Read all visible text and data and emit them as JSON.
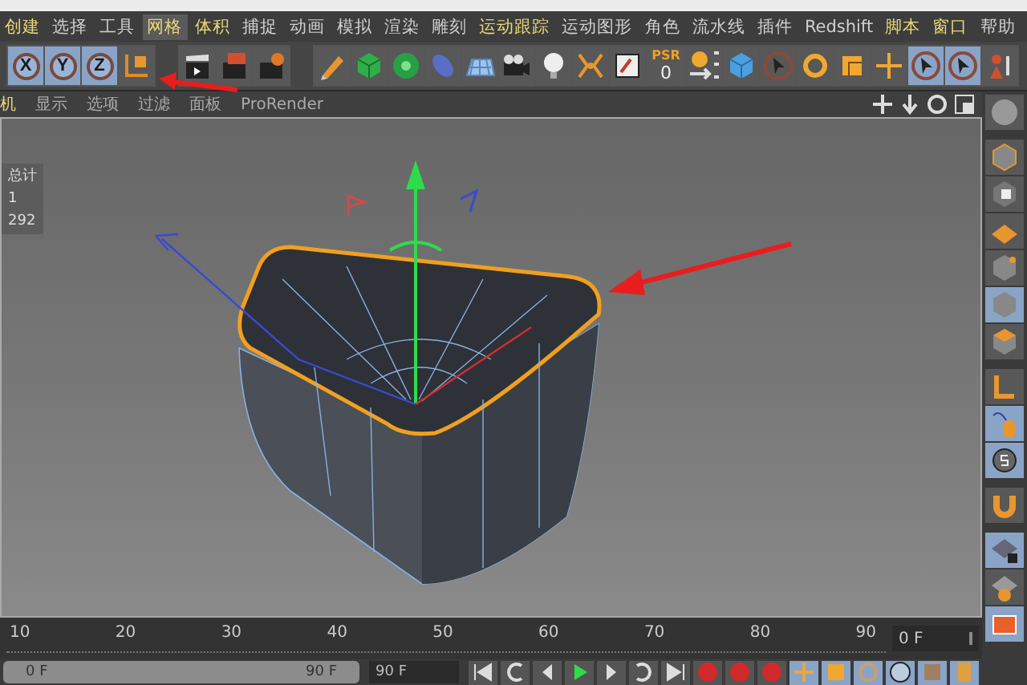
{
  "menu": [
    {
      "label": "创建",
      "color": "#e8d878",
      "selected": false
    },
    {
      "label": "选择",
      "color": "#d0d0d0",
      "selected": false
    },
    {
      "label": "工具",
      "color": "#d0d0d0",
      "selected": false
    },
    {
      "label": "网格",
      "color": "#e8d878",
      "selected": true
    },
    {
      "label": "体积",
      "color": "#e8d878",
      "selected": false
    },
    {
      "label": "捕捉",
      "color": "#d0d0d0",
      "selected": false
    },
    {
      "label": "动画",
      "color": "#d0d0d0",
      "selected": false
    },
    {
      "label": "模拟",
      "color": "#d0d0d0",
      "selected": false
    },
    {
      "label": "渲染",
      "color": "#d0d0d0",
      "selected": false
    },
    {
      "label": "雕刻",
      "color": "#d0d0d0",
      "selected": false
    },
    {
      "label": "运动跟踪",
      "color": "#e8d878",
      "selected": false
    },
    {
      "label": "运动图形",
      "color": "#d0d0d0",
      "selected": false
    },
    {
      "label": "角色",
      "color": "#d0d0d0",
      "selected": false
    },
    {
      "label": "流水线",
      "color": "#d0d0d0",
      "selected": false
    },
    {
      "label": "插件",
      "color": "#d0d0d0",
      "selected": false
    },
    {
      "label": "Redshift",
      "color": "#d0d0d0",
      "selected": false
    },
    {
      "label": "脚本",
      "color": "#e8d878",
      "selected": false
    },
    {
      "label": "窗口",
      "color": "#e8d878",
      "selected": false
    },
    {
      "label": "帮助",
      "color": "#d0d0d0",
      "selected": false
    }
  ],
  "toolbar": [
    [
      {
        "kind": "axis",
        "label": "X",
        "on": true
      },
      {
        "kind": "axis",
        "label": "Y",
        "on": true
      },
      {
        "kind": "axis",
        "label": "Z",
        "on": true
      },
      {
        "kind": "icon",
        "on": false
      }
    ],
    [
      {
        "kind": "icon",
        "on": false
      },
      {
        "kind": "icon",
        "on": false
      },
      {
        "kind": "icon",
        "on": false
      }
    ],
    [
      {
        "kind": "icon",
        "on": false
      },
      {
        "kind": "icon",
        "on": false
      },
      {
        "kind": "icon",
        "on": false
      },
      {
        "kind": "icon",
        "on": false
      },
      {
        "kind": "icon",
        "on": false
      },
      {
        "kind": "icon",
        "on": false
      },
      {
        "kind": "icon",
        "on": false
      },
      {
        "kind": "icon",
        "on": false
      },
      {
        "kind": "icon",
        "on": false
      },
      {
        "kind": "psr",
        "label": "PSR",
        "value": "0"
      },
      {
        "kind": "icon",
        "on": false
      },
      {
        "kind": "icon",
        "on": false
      },
      {
        "kind": "icon",
        "on": false
      },
      {
        "kind": "icon",
        "on": false
      },
      {
        "kind": "icon",
        "on": false
      },
      {
        "kind": "icon",
        "on": false
      },
      {
        "kind": "icon",
        "on": true
      },
      {
        "kind": "icon",
        "on": true
      },
      {
        "kind": "icon",
        "on": false
      }
    ]
  ],
  "viewport": {
    "menu": [
      "机",
      "显示",
      "选项",
      "过滤",
      "面板",
      "ProRender"
    ],
    "hud": [
      "总计",
      "1",
      "292"
    ]
  },
  "side_tools": [
    {
      "on": false
    },
    {
      "on": false
    },
    {
      "on": false
    },
    {
      "on": false
    },
    {
      "on": false
    },
    {
      "on": true
    },
    {
      "on": false
    },
    {
      "on": false
    },
    {
      "on": true
    },
    {
      "on": true
    },
    {
      "on": false
    },
    {
      "on": true
    },
    {
      "on": false
    },
    {
      "on": true
    }
  ],
  "timeline": {
    "ticks": [
      "10",
      "20",
      "30",
      "40",
      "50",
      "60",
      "70",
      "80",
      "90"
    ],
    "current_frame": "0 F"
  },
  "bottom": {
    "range_start": "0 F",
    "range_end": "90 F",
    "end_frame": "90 F"
  }
}
